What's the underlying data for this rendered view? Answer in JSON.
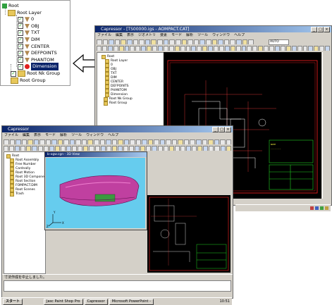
{
  "tree_zoom": {
    "items": [
      {
        "label": "Root",
        "icon": "root-node-icon",
        "checked": false
      },
      {
        "label": "Root Layer",
        "icon": "folder-icon",
        "checked": false
      },
      {
        "label": "0",
        "icon": "layer-icon",
        "checked": true
      },
      {
        "label": "OBJ",
        "icon": "layer-icon",
        "checked": true
      },
      {
        "label": "TXT",
        "icon": "layer-icon",
        "checked": true
      },
      {
        "label": "DIM",
        "icon": "layer-icon",
        "checked": true
      },
      {
        "label": "CENTER",
        "icon": "layer-icon",
        "checked": true
      },
      {
        "label": "DEFPOINTS",
        "icon": "layer-icon",
        "checked": true
      },
      {
        "label": "PHANTOM",
        "icon": "layer-icon",
        "checked": true
      },
      {
        "label": "Dimension",
        "icon": "dimension-icon",
        "checked": true,
        "selected": true
      },
      {
        "label": "Root Nk Group",
        "icon": "folder-icon",
        "checked": true
      },
      {
        "label": "Root Group",
        "icon": "folder-icon",
        "checked": false
      }
    ]
  },
  "back_window": {
    "title": "Capressor - [TS00000.igs - AOMPACT.CAT]",
    "menu": [
      "ファイル",
      "編集",
      "表示",
      "ジオメトリ",
      "要素",
      "モード",
      "解析",
      "ツール",
      "ウィンドウ",
      "ヘルプ"
    ],
    "zoom_value": "AUTO",
    "tree": [
      "Root",
      "Root Layer",
      "0",
      "OBJ",
      "TXT",
      "DIM",
      "CENTER",
      "DEFPOINTS",
      "PHANTOM",
      "Dimension",
      "Root Nk Group",
      "Root Group"
    ]
  },
  "front_window": {
    "title": "Capressor",
    "menu": [
      "ファイル",
      "編集",
      "表示",
      "モード",
      "解析",
      "ツール",
      "ウィンドウ",
      "ヘルプ"
    ],
    "tree": [
      "Root",
      "Root Assembly",
      "Free Number",
      "Cardnally",
      "Root Motion",
      "Root 3D Component",
      "Root Section",
      "FOMPACT.DIM",
      "Root Scenes",
      "Trash"
    ],
    "view_title": "b-ogw.cgn - 3D View",
    "status_text": "寸法作成を中止しました。"
  },
  "taskbar": {
    "start": "スタート",
    "buttons": [
      "Jasc Paint Shop Pro",
      "Capressor",
      "Microsoft PowerPoint -"
    ],
    "clock": "10:51"
  },
  "colors": {
    "titlebar": "#0a246a",
    "cad_bg": "#000000",
    "cad_red": "#ff2020",
    "cad_green": "#20d020",
    "view_bg": "#66ccee",
    "bumper": "#c040a0"
  }
}
